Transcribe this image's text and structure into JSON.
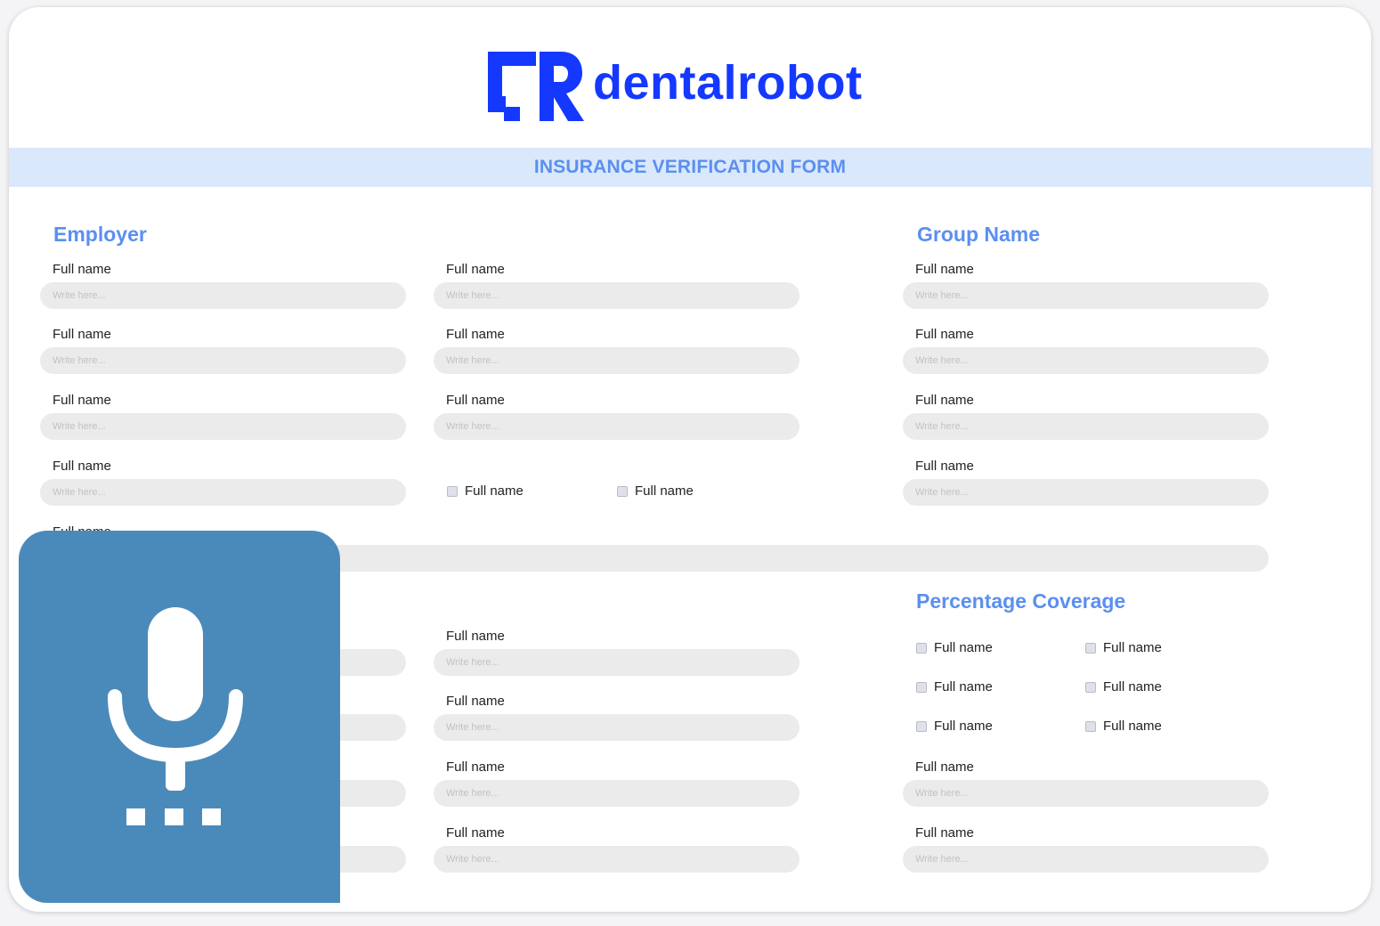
{
  "brand": {
    "name": "dentalrobot",
    "color": "#1538ff"
  },
  "form": {
    "title": "INSURANCE VERIFICATION FORM",
    "accent": "#5b8ff0",
    "sections": {
      "employer": "Employer",
      "group_name": "Group Name",
      "percentage_coverage": "Percentage Coverage"
    },
    "field_label": "Full name",
    "placeholder": "Write here...",
    "checkbox_label": "Full name"
  },
  "overlay": {
    "icon": "microphone-icon",
    "color": "#4a8abb"
  }
}
